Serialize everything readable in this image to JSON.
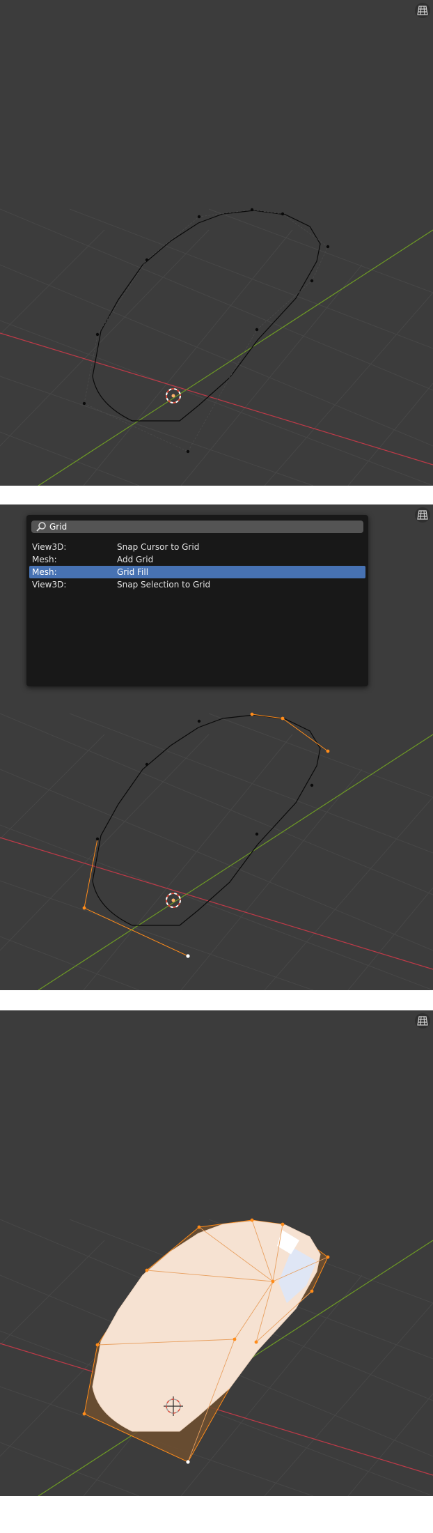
{
  "search_menu": {
    "query": "Grid",
    "results": [
      {
        "category": "View3D:",
        "label": "Snap Cursor to Grid",
        "active": false
      },
      {
        "category": "Mesh:",
        "label": "Add Grid",
        "active": false
      },
      {
        "category": "Mesh:",
        "label": "Grid Fill",
        "active": true
      },
      {
        "category": "View3D:",
        "label": "Snap Selection to Grid",
        "active": false
      }
    ]
  },
  "colors": {
    "viewport_bg": "#3c3c3c",
    "grid_line": "#454545",
    "x_axis": "#c13a48",
    "y_axis": "#6d9a25",
    "curve_wire": "#0a0a0a",
    "selected_vertex": "#ff8c1a",
    "active_vertex": "#ffffff",
    "highlight": "#4772b3",
    "fill_face": "#f6e2d2"
  },
  "icons": {
    "navigation": "view-grid-icon",
    "search": "magnifier-icon",
    "cursor": "3d-cursor-icon"
  }
}
